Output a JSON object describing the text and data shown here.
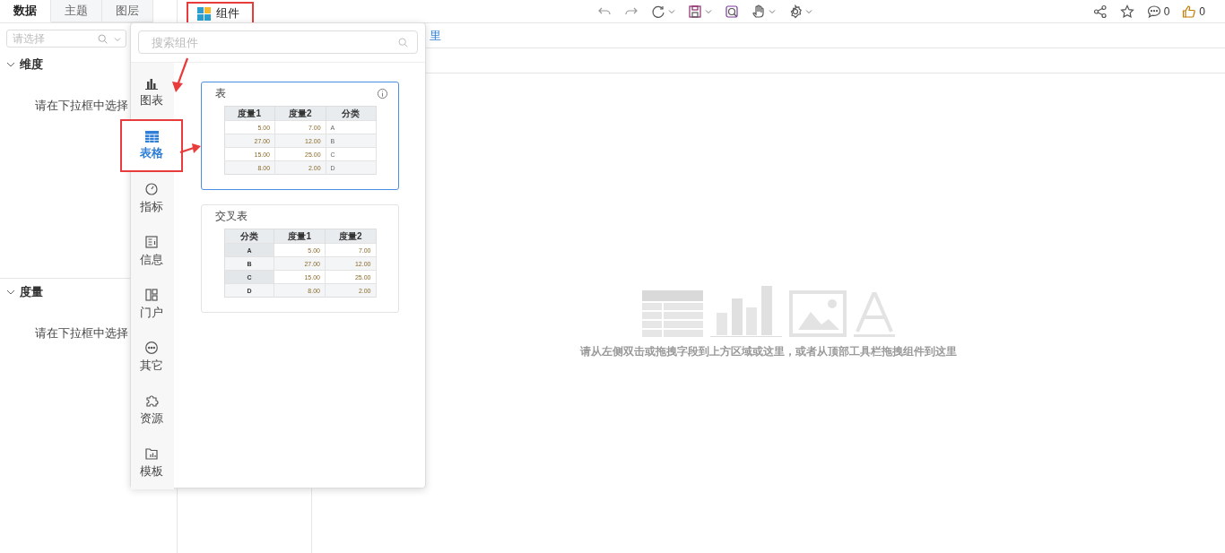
{
  "left_tabs": [
    {
      "label": "数据",
      "selected": true
    },
    {
      "label": "主题",
      "selected": false
    },
    {
      "label": "图层",
      "selected": false
    }
  ],
  "component_tab": {
    "label": "组件",
    "highlighted": true
  },
  "field_select": {
    "placeholder": "请选择"
  },
  "sections": [
    {
      "title": "维度",
      "expanded": true,
      "hint": "请在下拉框中选择"
    },
    {
      "title": "度量",
      "expanded": true,
      "hint": "请在下拉框中选择"
    }
  ],
  "toolbar": [
    {
      "kind": "undo",
      "caret": false
    },
    {
      "kind": "redo",
      "caret": false
    },
    {
      "kind": "refresh",
      "caret": true
    },
    {
      "kind": "save",
      "caret": true
    },
    {
      "kind": "preview",
      "caret": false
    },
    {
      "kind": "hand",
      "caret": true
    },
    {
      "kind": "settings",
      "caret": true
    }
  ],
  "actions": [
    {
      "kind": "share"
    },
    {
      "kind": "star"
    },
    {
      "kind": "comment",
      "count": "0"
    },
    {
      "kind": "like",
      "count": "0"
    }
  ],
  "strip_text": "里",
  "popup": {
    "search_placeholder": "搜索组件",
    "categories": [
      {
        "kind": "chart",
        "label": "图表",
        "selected": false,
        "highlighted": false
      },
      {
        "kind": "table",
        "label": "表格",
        "selected": true,
        "highlighted": true
      },
      {
        "kind": "gauge",
        "label": "指标",
        "selected": false,
        "highlighted": false
      },
      {
        "kind": "info",
        "label": "信息",
        "selected": false,
        "highlighted": false
      },
      {
        "kind": "portal",
        "label": "门户",
        "selected": false,
        "highlighted": false
      },
      {
        "kind": "other",
        "label": "其它",
        "selected": false,
        "highlighted": false
      },
      {
        "kind": "puzzle",
        "label": "资源",
        "selected": false,
        "highlighted": false
      },
      {
        "kind": "template",
        "label": "模板",
        "selected": false,
        "highlighted": false
      }
    ],
    "cards": [
      {
        "title": "表",
        "selected": true,
        "info": true,
        "header_column": false,
        "columns": [
          "度量1",
          "度量2",
          "分类"
        ],
        "rows": [
          [
            "5.00",
            "7.00",
            "A"
          ],
          [
            "27.00",
            "12.00",
            "B"
          ],
          [
            "15.00",
            "25.00",
            "C"
          ],
          [
            "8.00",
            "2.00",
            "D"
          ]
        ]
      },
      {
        "title": "交叉表",
        "selected": false,
        "info": false,
        "header_column": true,
        "columns": [
          "分类",
          "度量1",
          "度量2"
        ],
        "rows": [
          [
            "A",
            "5.00",
            "7.00"
          ],
          [
            "B",
            "27.00",
            "12.00"
          ],
          [
            "C",
            "15.00",
            "25.00"
          ],
          [
            "D",
            "8.00",
            "2.00"
          ]
        ]
      }
    ]
  },
  "empty_state": {
    "message": "请从左侧双击或拖拽字段到上方区域或这里，或者从顶部工具栏拖拽组件到这里"
  }
}
